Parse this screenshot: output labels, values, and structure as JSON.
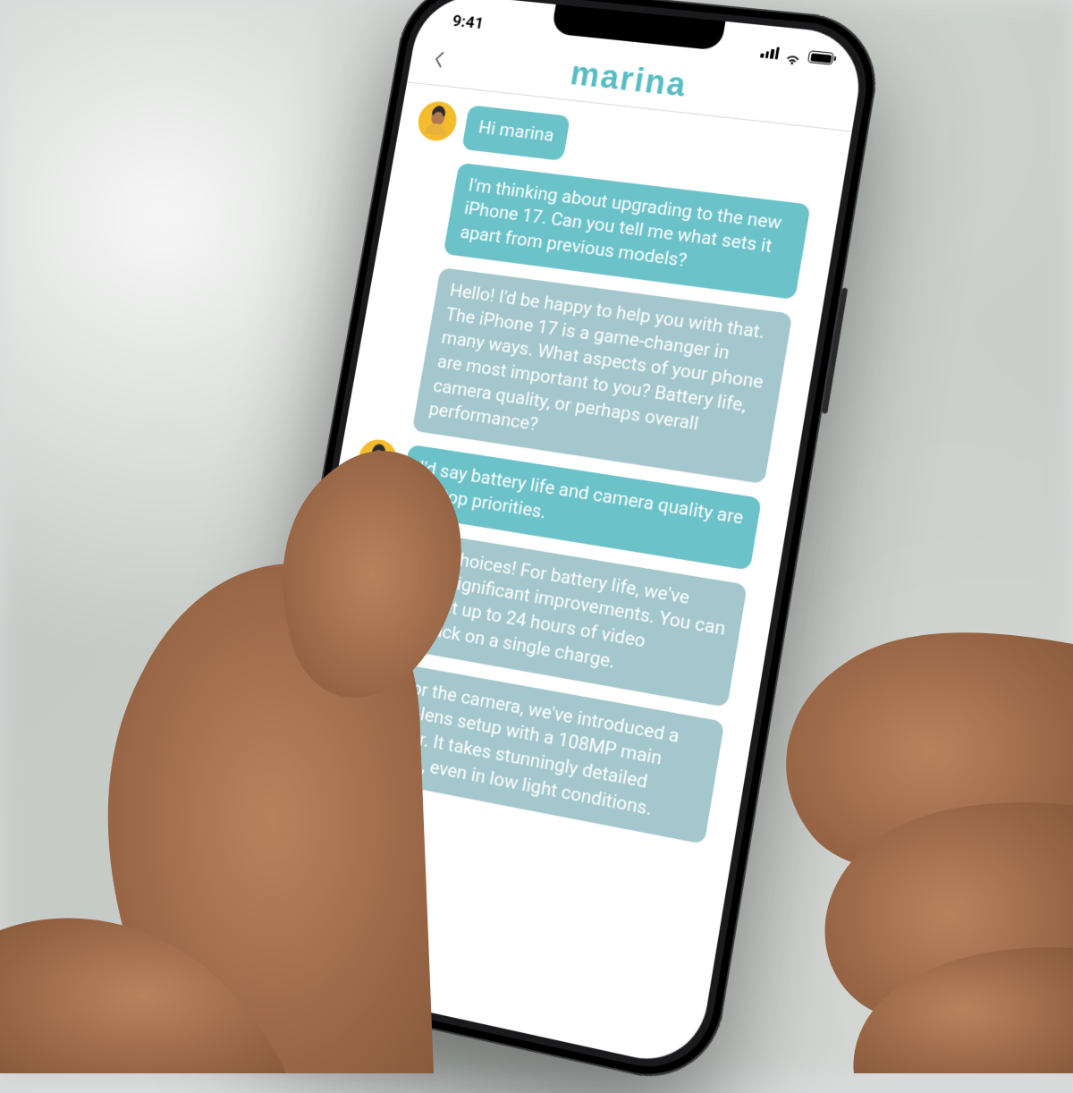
{
  "statusbar": {
    "time": "9:41"
  },
  "header": {
    "brand": "marina"
  },
  "messages": [
    {
      "role": "user",
      "withAvatar": true,
      "text": "Hi marina"
    },
    {
      "role": "user",
      "withAvatar": false,
      "text": "I'm thinking about upgrading to the new iPhone 17. Can you tell me what sets it apart from previous models?"
    },
    {
      "role": "bot",
      "withAvatar": false,
      "text": "Hello! I'd be happy to help you with that. The iPhone 17 is a game-changer in many ways. What aspects of your phone are most important to you? Battery life, camera quality, or perhaps overall performance?"
    },
    {
      "role": "user",
      "withAvatar": true,
      "text": "I'd say battery life and camera quality are my top priorities."
    },
    {
      "role": "bot",
      "withAvatar": false,
      "text": "Great choices! For battery life, we've made significant improvements. You can now get up to 24 hours of video playback on a single charge."
    },
    {
      "role": "bot",
      "withAvatar": false,
      "text": "As for the camera, we've introduced a quad-lens setup with a 108MP main sensor. It takes stunningly detailed photos, even in low light conditions."
    }
  ],
  "colors": {
    "brand": "#58bcc4",
    "userBubble": "#6cc2c9",
    "botBubble": "#a3c7cc"
  }
}
